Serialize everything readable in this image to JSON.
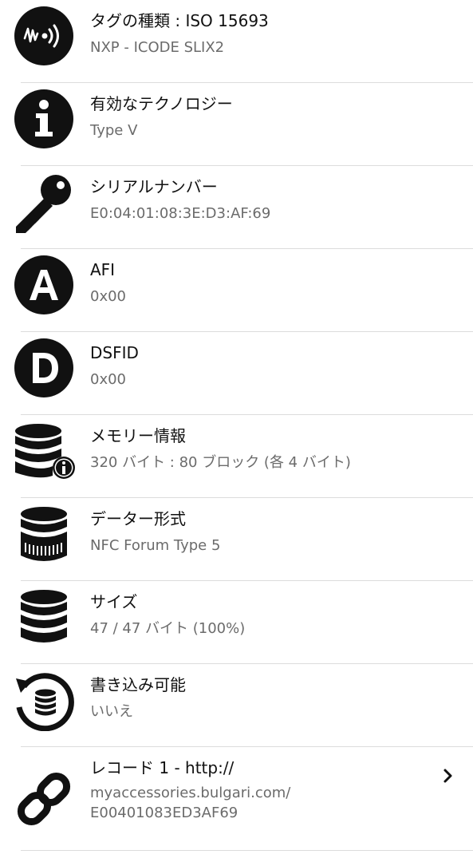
{
  "rows": [
    {
      "icon": "nfc-tag-icon",
      "title": "タグの種類 : ISO 15693",
      "value": "NXP - ICODE SLIX2"
    },
    {
      "icon": "info-icon",
      "title": "有効なテクノロジー",
      "value": "Type V"
    },
    {
      "icon": "key-icon",
      "title": "シリアルナンバー",
      "value": "E0:04:01:08:3E:D3:AF:69"
    },
    {
      "icon": "letter-a-icon",
      "title": "AFI",
      "value": "0x00"
    },
    {
      "icon": "letter-d-icon",
      "title": "DSFID",
      "value": "0x00"
    },
    {
      "icon": "database-info-icon",
      "title": "メモリー情報",
      "value": "320 バイト : 80 ブロック (各 4 バイト)"
    },
    {
      "icon": "database-format-icon",
      "title": "データー形式",
      "value": "NFC Forum Type 5"
    },
    {
      "icon": "database-icon",
      "title": "サイズ",
      "value": "47 / 47 バイト (100%)"
    },
    {
      "icon": "database-rewrite-icon",
      "title": "書き込み可能",
      "value": "いいえ"
    },
    {
      "icon": "link-icon",
      "title": "レコード 1 - http://",
      "value_lines": [
        "myaccessories.bulgari.com/",
        "E00401083ED3AF69"
      ]
    }
  ],
  "colors": {
    "icon": "#111111",
    "title": "#111111",
    "value": "#6b6b6b",
    "divider": "#dcdcdc"
  }
}
